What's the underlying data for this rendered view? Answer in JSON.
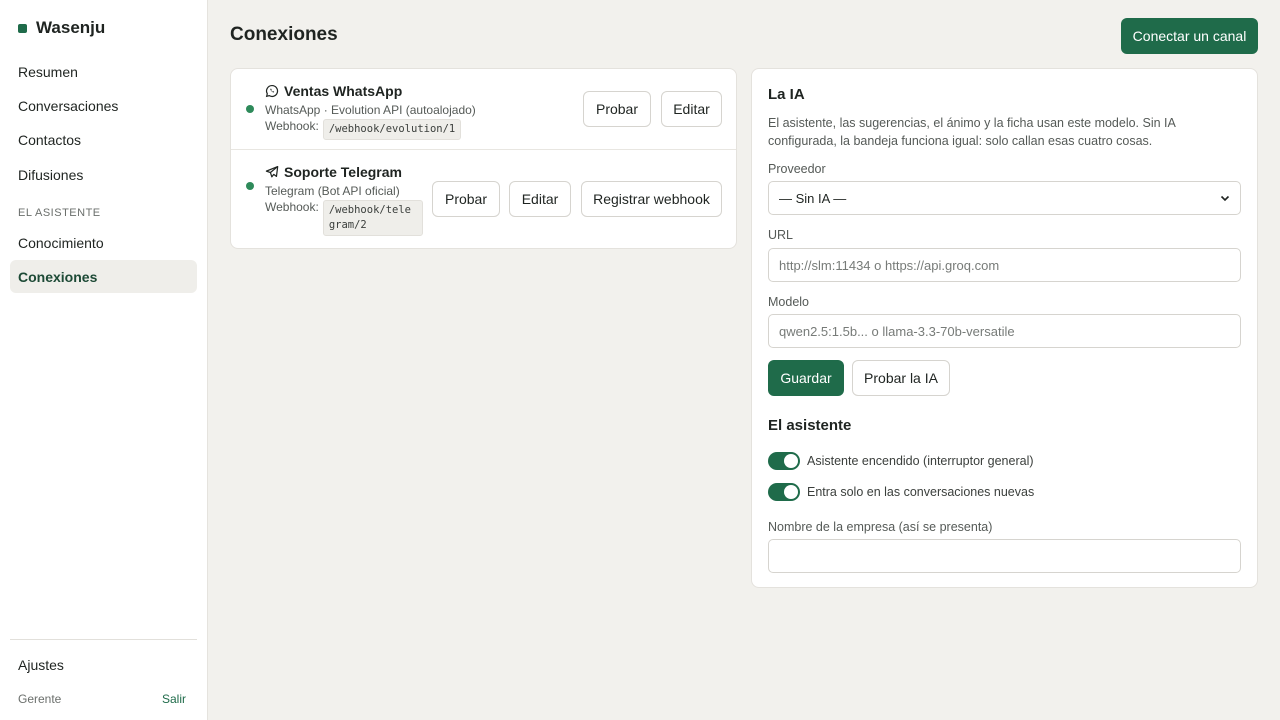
{
  "app": {
    "name": "Wasenju"
  },
  "sidebar": {
    "items": [
      {
        "label": "Resumen"
      },
      {
        "label": "Conversaciones"
      },
      {
        "label": "Contactos"
      },
      {
        "label": "Difusiones"
      }
    ],
    "section_label": "EL ASISTENTE",
    "section_items": [
      {
        "label": "Conocimiento"
      },
      {
        "label": "Conexiones",
        "active": true
      }
    ],
    "settings_label": "Ajustes",
    "user_role": "Gerente",
    "logout_label": "Salir"
  },
  "header": {
    "title": "Conexiones",
    "connect_label": "Conectar un canal"
  },
  "channels": [
    {
      "name": "Ventas WhatsApp",
      "icon": "whatsapp-icon",
      "meta": "WhatsApp · Evolution API (autoalojado)",
      "webhook_label": "Webhook:",
      "webhook_path": "/webhook/evolution/1",
      "status_color": "#2e8a5a",
      "test_label": "Probar",
      "edit_label": "Editar"
    },
    {
      "name": "Soporte Telegram",
      "icon": "telegram-icon",
      "meta": "Telegram (Bot API oficial)",
      "webhook_label": "Webhook:",
      "webhook_path": "/webhook/telegram/2",
      "status_color": "#2e8a5a",
      "test_label": "Probar",
      "edit_label": "Editar",
      "register_label": "Registrar webhook"
    }
  ],
  "ia": {
    "title": "La IA",
    "description": "El asistente, las sugerencias, el ánimo y la ficha usan este modelo. Sin IA configurada, la bandeja funciona igual: solo callan esas cuatro cosas.",
    "provider_label": "Proveedor",
    "provider_value": "— Sin IA —",
    "url_label": "URL",
    "url_placeholder": "http://slm:11434 o https://api.groq.com",
    "model_label": "Modelo",
    "model_placeholder": "qwen2.5:1.5b... o llama-3.3-70b-versatile",
    "save_label": "Guardar",
    "test_label": "Probar la IA"
  },
  "assistant": {
    "title": "El asistente",
    "toggle_on_label": "Asistente encendido (interruptor general)",
    "toggle_on_value": true,
    "toggle_new_label": "Entra solo en las conversaciones nuevas",
    "toggle_new_value": true,
    "company_label": "Nombre de la empresa (así se presenta)",
    "company_value": ""
  },
  "colors": {
    "accent": "#1f6b4a",
    "status_online": "#2e8a5a",
    "background": "#f2f1ed"
  }
}
